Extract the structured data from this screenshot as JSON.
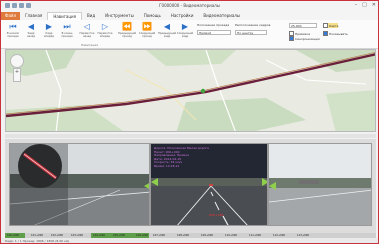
{
  "window": {
    "title": "Г0000000 - Видеоматериалы",
    "controls": [
      "–",
      "□",
      "✕"
    ]
  },
  "menu": {
    "items": [
      "Файл",
      "Главная",
      "Навигация",
      "Вид",
      "Инструменты",
      "Помощь",
      "Настройки",
      "Видеоматериалы"
    ]
  },
  "ribbon": {
    "buttons": [
      {
        "label": "В начало\nпроезда",
        "icon": "skip-start-icon",
        "glyph": "⏮"
      },
      {
        "label": "Кадр\nназад",
        "icon": "step-back-icon",
        "glyph": "◀"
      },
      {
        "label": "Кадр\nвперёд",
        "icon": "step-forward-icon",
        "glyph": "▶"
      },
      {
        "label": "В конец\nпроезда",
        "icon": "skip-end-icon",
        "glyph": "⏭"
      },
      {
        "label": "Перемотка\nназад",
        "icon": "rewind-icon",
        "glyph": "◁"
      },
      {
        "label": "Перемотка\nвперёд",
        "icon": "forward-icon",
        "glyph": "▷"
      },
      {
        "label": "Предыдущий\nпроезд",
        "icon": "prev-pass-icon",
        "glyph": "⏪"
      },
      {
        "label": "Следующий\nпроезд",
        "icon": "next-pass-icon",
        "glyph": "⏩"
      },
      {
        "label": "Предыдущий\nкадр",
        "icon": "prev-frame-icon",
        "glyph": "◀"
      },
      {
        "label": "Следующий\nкадр",
        "icon": "next-frame-icon",
        "glyph": "▶"
      }
    ],
    "group_label": "Навигация",
    "position_label": "Положение проезда",
    "position_value": "Прямой",
    "sort_label": "Расположение кадров",
    "sort_value": "По центру",
    "speed_value": "25.000",
    "checks": [
      {
        "label": "Привязка",
        "checked": false
      },
      {
        "label": "Синхронизация",
        "checked": true
      },
      {
        "label": "Карта",
        "checked": false
      },
      {
        "label": "Показывать",
        "checked": true
      }
    ]
  },
  "video": {
    "info_lines": [
      "Дорога: Московская Малая дорога",
      "Пикет: 000+000",
      "Направление: Прямое",
      "Дата: 2014-04-10",
      "Скорость: 54 км/ч",
      "Время: 14:26:12"
    ],
    "center_overlay": "ПК0+080"
  },
  "timeline": {
    "segments": [
      "100+000",
      "104+000",
      "105+000",
      "106+000"
    ],
    "labels": [
      "101+000",
      "102+000",
      "103+000",
      "107+000",
      "108+000",
      "109+000",
      "110+000",
      "111+000",
      "112+000",
      "113+000"
    ]
  },
  "status": {
    "text": "Кадр: 1 / 1        Проезд: 1806 / 1806 (8.06 км)"
  },
  "colors": {
    "accent": "#c8323c",
    "file_tab": "#e07a3c",
    "route": "#6a1f3a",
    "timeline_segment": "#5f9e4a"
  }
}
